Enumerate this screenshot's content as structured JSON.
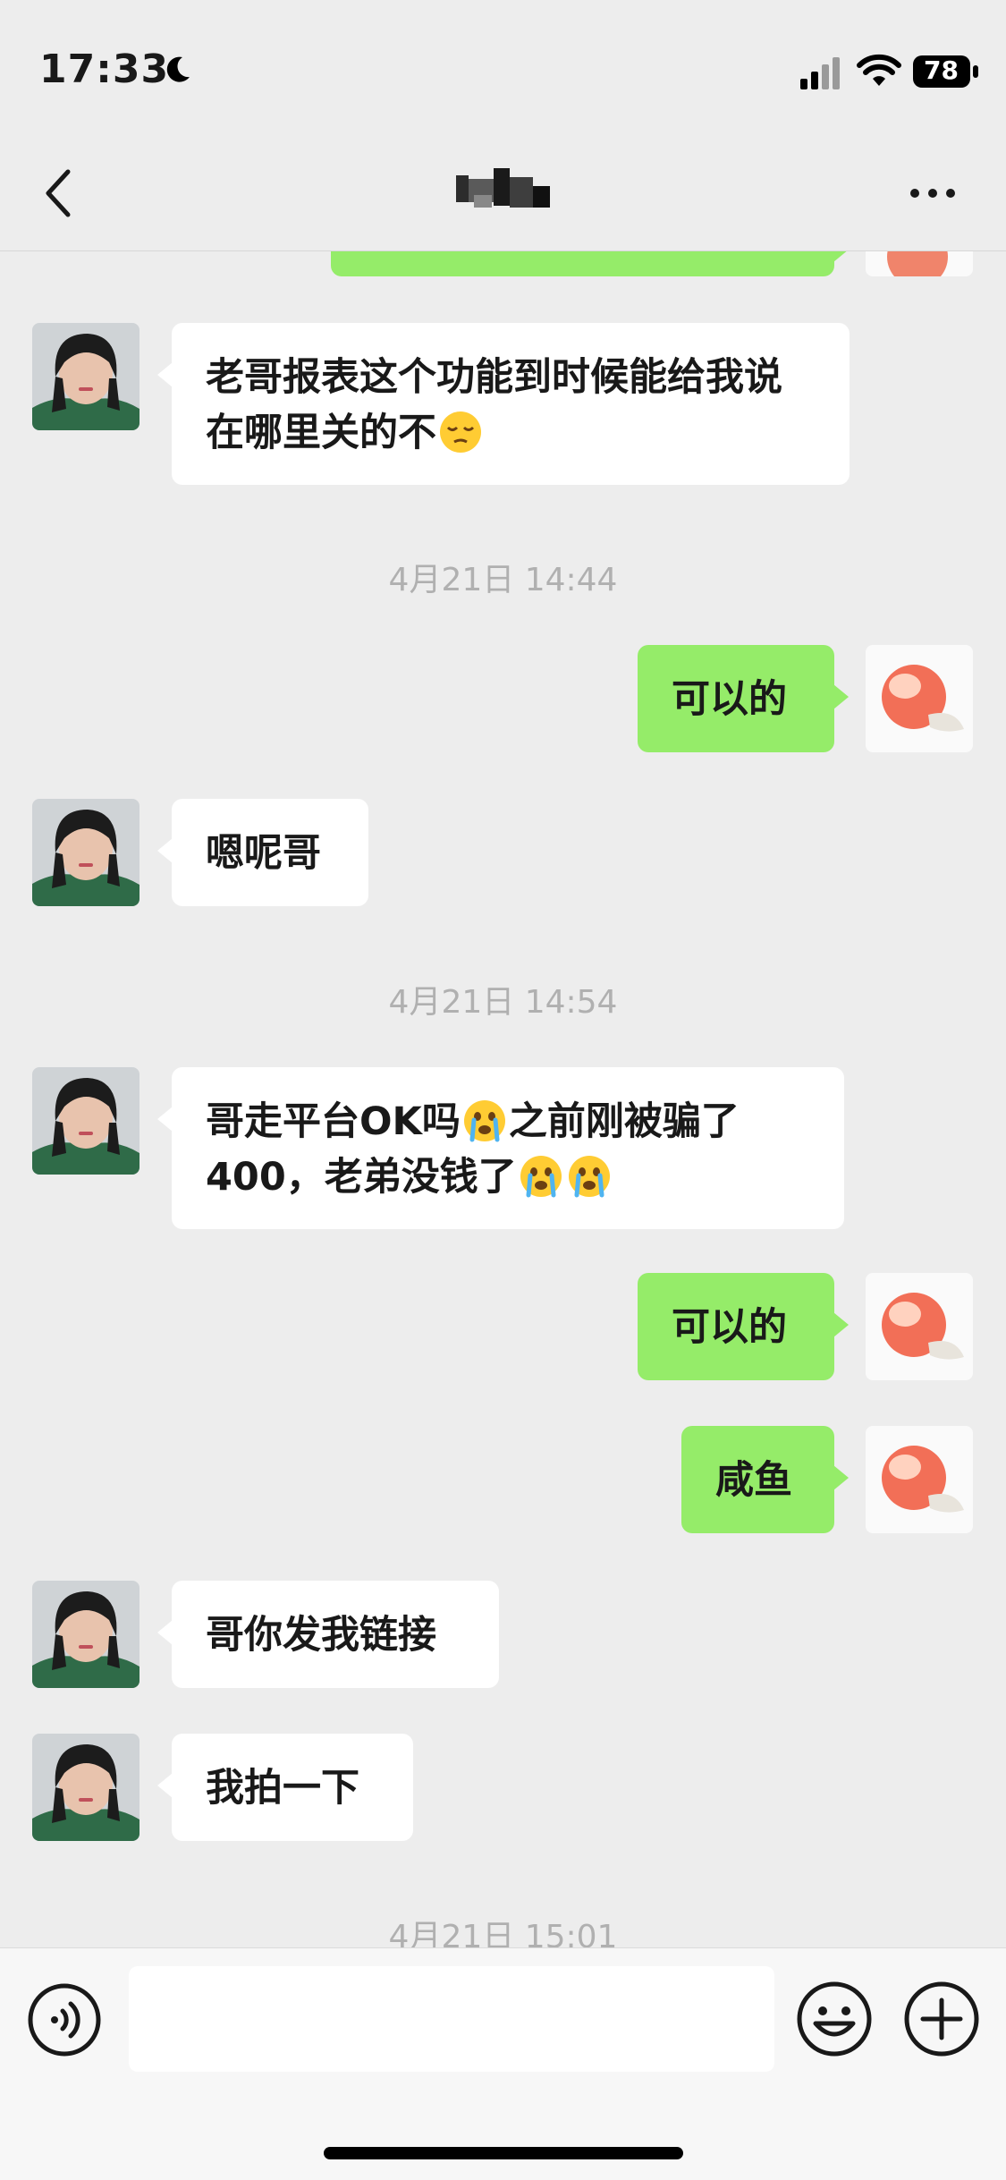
{
  "status_bar": {
    "time": "17:33",
    "battery": "78",
    "icons": [
      "moon-icon",
      "cellular-signal-icon",
      "wifi-icon",
      "battery-icon"
    ]
  },
  "nav": {
    "title": "",
    "back_icon": "chevron-left-icon",
    "more_icon": "ellipsis-icon"
  },
  "messages": [
    {
      "type": "outgoing",
      "text": ""
    },
    {
      "type": "incoming",
      "text": "老哥报表这个功能到时候能给我说在哪里关的不",
      "emoji": "sleepy-face"
    },
    {
      "type": "timestamp",
      "text": "4月21日 14:44"
    },
    {
      "type": "outgoing",
      "text": "可以的"
    },
    {
      "type": "incoming",
      "text": "嗯呢哥"
    },
    {
      "type": "timestamp",
      "text": "4月21日 14:54"
    },
    {
      "type": "incoming",
      "text_parts": [
        "哥走平台OK吗",
        "之前刚被骗了400，老弟没钱了"
      ],
      "emoji": "crying-face"
    },
    {
      "type": "outgoing",
      "text": "可以的"
    },
    {
      "type": "outgoing",
      "text": "咸鱼"
    },
    {
      "type": "incoming",
      "text": "哥你发我链接"
    },
    {
      "type": "incoming",
      "text": "我拍一下"
    },
    {
      "type": "timestamp",
      "text": "4月21日 15:01"
    }
  ],
  "input_bar": {
    "placeholder": "",
    "icons": [
      "voice-icon",
      "emoji-icon",
      "plus-icon"
    ]
  },
  "colors": {
    "background": "#ededed",
    "outgoing_bubble": "#95ec69",
    "incoming_bubble": "#ffffff",
    "timestamp": "#b0b0b0"
  }
}
